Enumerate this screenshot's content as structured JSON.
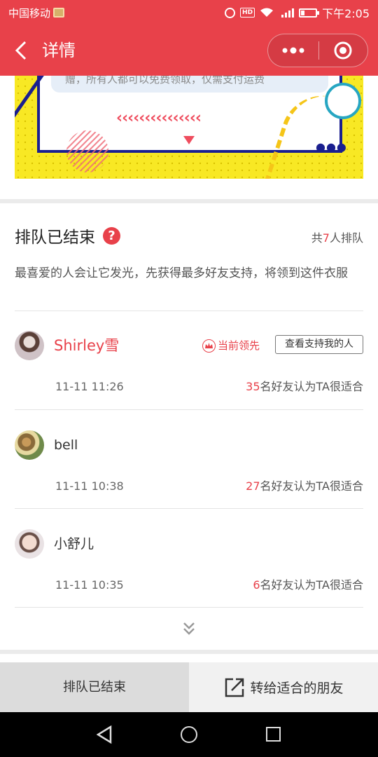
{
  "status_bar": {
    "carrier": "中国移动",
    "time": "下午2:05",
    "icons": [
      "sim-card-icon",
      "alarm-icon",
      "hd-icon",
      "wifi-icon",
      "signal-4g-icon",
      "battery-icon"
    ]
  },
  "nav": {
    "title": "详情",
    "back_icon": "back-icon",
    "more_icon": "more-icon",
    "close_icon": "close-icon"
  },
  "banner": {
    "text": "赠，所有人都可以免费领取，仅需支付运费",
    "chevrons": "‹‹‹‹‹‹‹‹‹‹‹‹‹‹‹",
    "dots": "●●●"
  },
  "queue": {
    "title": "排队已结束",
    "count_prefix": "共",
    "count_number": "7",
    "count_suffix": "人排队",
    "description": "最喜爱的人会让它发光，先获得最多好友支持，将领到这件衣服"
  },
  "entries": [
    {
      "name": "Shirley雪",
      "time": "11-11 11:26",
      "votes": "35",
      "votes_suffix": "名好友认为TA很适合",
      "leading_label": "当前领先",
      "supporters_button": "查看支持我的人"
    },
    {
      "name": "bell",
      "time": "11-11 10:38",
      "votes": "27",
      "votes_suffix": "名好友认为TA很适合"
    },
    {
      "name": "小舒儿",
      "time": "11-11 10:35",
      "votes": "6",
      "votes_suffix": "名好友认为TA很适合"
    }
  ],
  "bottom_bar": {
    "ended_label": "排队已结束",
    "share_label": "转给适合的朋友"
  },
  "colors": {
    "accent": "#e8414a",
    "banner_yellow": "#f8e824",
    "banner_navy": "#1a1f8f"
  }
}
